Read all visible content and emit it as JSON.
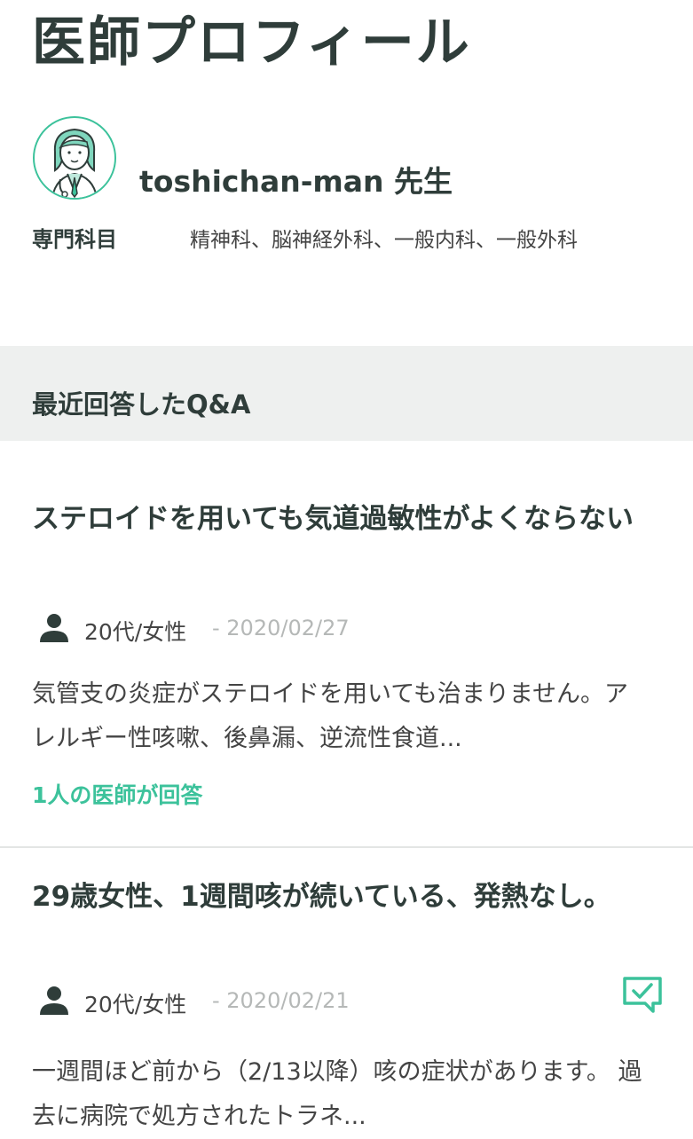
{
  "page": {
    "title": "医師プロフィール"
  },
  "doctor": {
    "name": "toshichan-man 先生",
    "specialty_label": "専門科目",
    "specialties": "精神科、脳神経外科、一般内科、一般外科"
  },
  "section": {
    "title": "最近回答したQ&A"
  },
  "qa": [
    {
      "title": "ステロイドを用いても気道過敏性がよくならない",
      "author": "20代/女性",
      "date": "- 2020/02/27",
      "body": "気管支の炎症がステロイドを用いても治まりません。アレルギー性咳嗽、後鼻漏、逆流性食道...",
      "answers": "1人の医師が回答"
    },
    {
      "title": "29歳女性、1週間咳が続いている、発熱なし。",
      "author": "20代/女性",
      "date": "- 2020/02/21",
      "body": "一週間ほど前から（2/13以降）咳の症状があります。 過去に病院で処方されたトラネ...",
      "answered_icon": "chat-check-icon"
    }
  ],
  "colors": {
    "accent": "#3cc29b",
    "heading": "#2f3d3a",
    "band": "#eef0ef"
  }
}
